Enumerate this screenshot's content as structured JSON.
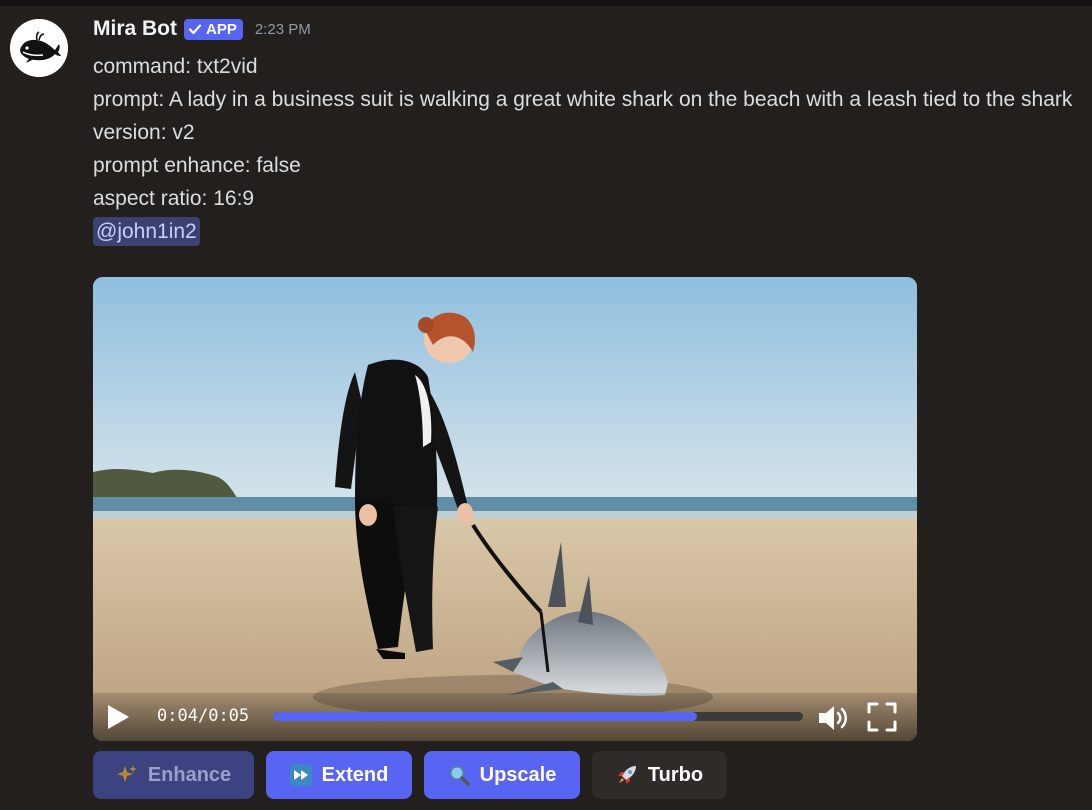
{
  "message": {
    "username": "Mira Bot",
    "badge_label": "APP",
    "timestamp": "2:23 PM",
    "avatar_icon": "whale-icon",
    "lines": {
      "command": "command: txt2vid",
      "prompt": "prompt: A lady in a business suit is walking a great white shark on the beach with a leash tied to the shark",
      "version": "version: v2",
      "prompt_enhance": "prompt enhance: false",
      "aspect_ratio": "aspect ratio: 16:9"
    },
    "mention": "@john1in2"
  },
  "video": {
    "current_time": "0:04",
    "separator": "/",
    "duration": "0:05",
    "progress": 0.8,
    "play_icon": "play-icon",
    "volume_icon": "volume-icon",
    "fullscreen_icon": "fullscreen-icon"
  },
  "buttons": [
    {
      "label": "Enhance",
      "icon": "sparkles-icon",
      "state": "disabled"
    },
    {
      "label": "Extend",
      "icon": "fast-forward-icon",
      "state": "primary"
    },
    {
      "label": "Upscale",
      "icon": "magnifier-icon",
      "state": "primary"
    },
    {
      "label": "Turbo",
      "icon": "rocket-icon",
      "state": "secondary"
    }
  ],
  "colors": {
    "accent": "#5865f2",
    "background": "#221f1d",
    "mention_bg": "#3c4270"
  }
}
